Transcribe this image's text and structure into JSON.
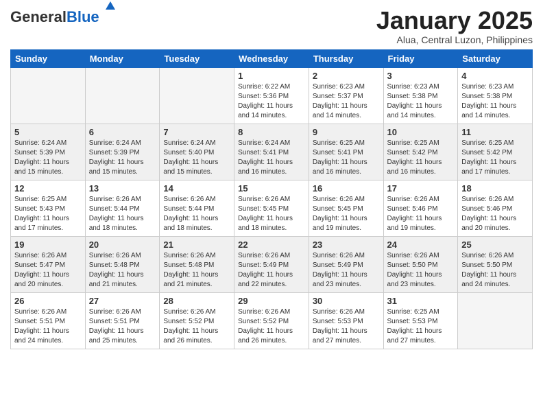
{
  "header": {
    "logo_general": "General",
    "logo_blue": "Blue",
    "month_title": "January 2025",
    "location": "Alua, Central Luzon, Philippines"
  },
  "weekdays": [
    "Sunday",
    "Monday",
    "Tuesday",
    "Wednesday",
    "Thursday",
    "Friday",
    "Saturday"
  ],
  "weeks": [
    [
      {
        "day": "",
        "sunrise": "",
        "sunset": "",
        "daylight": "",
        "empty": true
      },
      {
        "day": "",
        "sunrise": "",
        "sunset": "",
        "daylight": "",
        "empty": true
      },
      {
        "day": "",
        "sunrise": "",
        "sunset": "",
        "daylight": "",
        "empty": true
      },
      {
        "day": "1",
        "sunrise": "Sunrise: 6:22 AM",
        "sunset": "Sunset: 5:36 PM",
        "daylight": "Daylight: 11 hours and 14 minutes.",
        "empty": false
      },
      {
        "day": "2",
        "sunrise": "Sunrise: 6:23 AM",
        "sunset": "Sunset: 5:37 PM",
        "daylight": "Daylight: 11 hours and 14 minutes.",
        "empty": false
      },
      {
        "day": "3",
        "sunrise": "Sunrise: 6:23 AM",
        "sunset": "Sunset: 5:38 PM",
        "daylight": "Daylight: 11 hours and 14 minutes.",
        "empty": false
      },
      {
        "day": "4",
        "sunrise": "Sunrise: 6:23 AM",
        "sunset": "Sunset: 5:38 PM",
        "daylight": "Daylight: 11 hours and 14 minutes.",
        "empty": false
      }
    ],
    [
      {
        "day": "5",
        "sunrise": "Sunrise: 6:24 AM",
        "sunset": "Sunset: 5:39 PM",
        "daylight": "Daylight: 11 hours and 15 minutes.",
        "empty": false
      },
      {
        "day": "6",
        "sunrise": "Sunrise: 6:24 AM",
        "sunset": "Sunset: 5:39 PM",
        "daylight": "Daylight: 11 hours and 15 minutes.",
        "empty": false
      },
      {
        "day": "7",
        "sunrise": "Sunrise: 6:24 AM",
        "sunset": "Sunset: 5:40 PM",
        "daylight": "Daylight: 11 hours and 15 minutes.",
        "empty": false
      },
      {
        "day": "8",
        "sunrise": "Sunrise: 6:24 AM",
        "sunset": "Sunset: 5:41 PM",
        "daylight": "Daylight: 11 hours and 16 minutes.",
        "empty": false
      },
      {
        "day": "9",
        "sunrise": "Sunrise: 6:25 AM",
        "sunset": "Sunset: 5:41 PM",
        "daylight": "Daylight: 11 hours and 16 minutes.",
        "empty": false
      },
      {
        "day": "10",
        "sunrise": "Sunrise: 6:25 AM",
        "sunset": "Sunset: 5:42 PM",
        "daylight": "Daylight: 11 hours and 16 minutes.",
        "empty": false
      },
      {
        "day": "11",
        "sunrise": "Sunrise: 6:25 AM",
        "sunset": "Sunset: 5:42 PM",
        "daylight": "Daylight: 11 hours and 17 minutes.",
        "empty": false
      }
    ],
    [
      {
        "day": "12",
        "sunrise": "Sunrise: 6:25 AM",
        "sunset": "Sunset: 5:43 PM",
        "daylight": "Daylight: 11 hours and 17 minutes.",
        "empty": false
      },
      {
        "day": "13",
        "sunrise": "Sunrise: 6:26 AM",
        "sunset": "Sunset: 5:44 PM",
        "daylight": "Daylight: 11 hours and 18 minutes.",
        "empty": false
      },
      {
        "day": "14",
        "sunrise": "Sunrise: 6:26 AM",
        "sunset": "Sunset: 5:44 PM",
        "daylight": "Daylight: 11 hours and 18 minutes.",
        "empty": false
      },
      {
        "day": "15",
        "sunrise": "Sunrise: 6:26 AM",
        "sunset": "Sunset: 5:45 PM",
        "daylight": "Daylight: 11 hours and 18 minutes.",
        "empty": false
      },
      {
        "day": "16",
        "sunrise": "Sunrise: 6:26 AM",
        "sunset": "Sunset: 5:45 PM",
        "daylight": "Daylight: 11 hours and 19 minutes.",
        "empty": false
      },
      {
        "day": "17",
        "sunrise": "Sunrise: 6:26 AM",
        "sunset": "Sunset: 5:46 PM",
        "daylight": "Daylight: 11 hours and 19 minutes.",
        "empty": false
      },
      {
        "day": "18",
        "sunrise": "Sunrise: 6:26 AM",
        "sunset": "Sunset: 5:46 PM",
        "daylight": "Daylight: 11 hours and 20 minutes.",
        "empty": false
      }
    ],
    [
      {
        "day": "19",
        "sunrise": "Sunrise: 6:26 AM",
        "sunset": "Sunset: 5:47 PM",
        "daylight": "Daylight: 11 hours and 20 minutes.",
        "empty": false
      },
      {
        "day": "20",
        "sunrise": "Sunrise: 6:26 AM",
        "sunset": "Sunset: 5:48 PM",
        "daylight": "Daylight: 11 hours and 21 minutes.",
        "empty": false
      },
      {
        "day": "21",
        "sunrise": "Sunrise: 6:26 AM",
        "sunset": "Sunset: 5:48 PM",
        "daylight": "Daylight: 11 hours and 21 minutes.",
        "empty": false
      },
      {
        "day": "22",
        "sunrise": "Sunrise: 6:26 AM",
        "sunset": "Sunset: 5:49 PM",
        "daylight": "Daylight: 11 hours and 22 minutes.",
        "empty": false
      },
      {
        "day": "23",
        "sunrise": "Sunrise: 6:26 AM",
        "sunset": "Sunset: 5:49 PM",
        "daylight": "Daylight: 11 hours and 23 minutes.",
        "empty": false
      },
      {
        "day": "24",
        "sunrise": "Sunrise: 6:26 AM",
        "sunset": "Sunset: 5:50 PM",
        "daylight": "Daylight: 11 hours and 23 minutes.",
        "empty": false
      },
      {
        "day": "25",
        "sunrise": "Sunrise: 6:26 AM",
        "sunset": "Sunset: 5:50 PM",
        "daylight": "Daylight: 11 hours and 24 minutes.",
        "empty": false
      }
    ],
    [
      {
        "day": "26",
        "sunrise": "Sunrise: 6:26 AM",
        "sunset": "Sunset: 5:51 PM",
        "daylight": "Daylight: 11 hours and 24 minutes.",
        "empty": false
      },
      {
        "day": "27",
        "sunrise": "Sunrise: 6:26 AM",
        "sunset": "Sunset: 5:51 PM",
        "daylight": "Daylight: 11 hours and 25 minutes.",
        "empty": false
      },
      {
        "day": "28",
        "sunrise": "Sunrise: 6:26 AM",
        "sunset": "Sunset: 5:52 PM",
        "daylight": "Daylight: 11 hours and 26 minutes.",
        "empty": false
      },
      {
        "day": "29",
        "sunrise": "Sunrise: 6:26 AM",
        "sunset": "Sunset: 5:52 PM",
        "daylight": "Daylight: 11 hours and 26 minutes.",
        "empty": false
      },
      {
        "day": "30",
        "sunrise": "Sunrise: 6:26 AM",
        "sunset": "Sunset: 5:53 PM",
        "daylight": "Daylight: 11 hours and 27 minutes.",
        "empty": false
      },
      {
        "day": "31",
        "sunrise": "Sunrise: 6:25 AM",
        "sunset": "Sunset: 5:53 PM",
        "daylight": "Daylight: 11 hours and 27 minutes.",
        "empty": false
      },
      {
        "day": "",
        "sunrise": "",
        "sunset": "",
        "daylight": "",
        "empty": true
      }
    ]
  ]
}
